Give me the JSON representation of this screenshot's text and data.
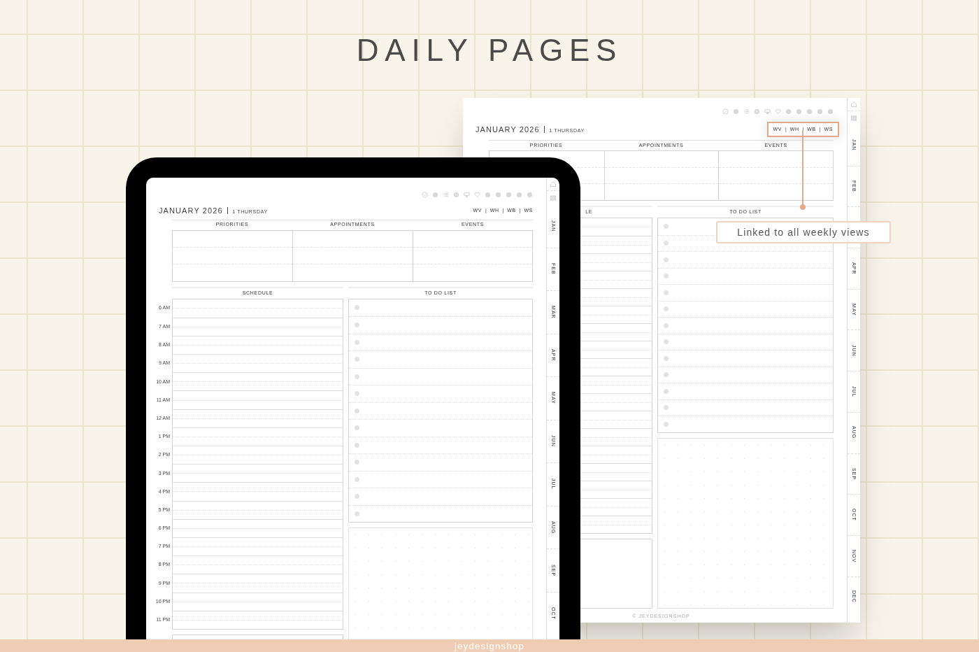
{
  "title": "DAILY PAGES",
  "back_page": {
    "month": "JANUARY 2026",
    "day": "1 THURSDAY",
    "separator": "|",
    "week_links": [
      "WV",
      "WH",
      "WB",
      "WS"
    ],
    "week_links_highlighted": true,
    "columns": [
      "PRIORITIES",
      "APPOINTMENTS",
      "EVENTS"
    ],
    "schedule_heading": "LE",
    "todo_heading": "TO DO LIST",
    "copyright": "© JEYDESIGNSHOP",
    "tabs": [
      {
        "label": "JAN"
      },
      {
        "label": "FEB"
      },
      {
        "kind": "covered"
      },
      {
        "label": "APR"
      },
      {
        "label": "MAY"
      },
      {
        "label": "JUN"
      },
      {
        "label": "JUL"
      },
      {
        "label": "AUG"
      },
      {
        "label": "SEP"
      },
      {
        "label": "OCT"
      },
      {
        "label": "NOV"
      },
      {
        "label": "DEC"
      }
    ]
  },
  "callout": "Linked to all weekly views",
  "tablet_page": {
    "month": "JANUARY 2026",
    "day": "1 THURSDAY",
    "separator": "|",
    "week_links": [
      "WV",
      "WH",
      "WB",
      "WS"
    ],
    "week_links_highlighted": false,
    "columns": [
      "PRIORITIES",
      "APPOINTMENTS",
      "EVENTS"
    ],
    "schedule_heading": "SCHEDULE",
    "hours": [
      "6 AM",
      "7 AM",
      "8 AM",
      "9 AM",
      "10 AM",
      "11 AM",
      "12 AM",
      "1 PM",
      "2 PM",
      "3 PM",
      "4 PM",
      "5 PM",
      "6 PM",
      "7 PM",
      "8 PM",
      "9 PM",
      "10 PM",
      "11 PM"
    ],
    "todo_heading": "TO DO LIST",
    "tabs": [
      {
        "label": "JAN"
      },
      {
        "label": "FEB"
      },
      {
        "label": "MAR"
      },
      {
        "label": "APR"
      },
      {
        "label": "MAY"
      },
      {
        "label": "JUN"
      },
      {
        "label": "JUL"
      },
      {
        "label": "AUG"
      },
      {
        "label": "SEP"
      },
      {
        "label": "OCT"
      }
    ]
  },
  "footer": "jeydesignshop"
}
